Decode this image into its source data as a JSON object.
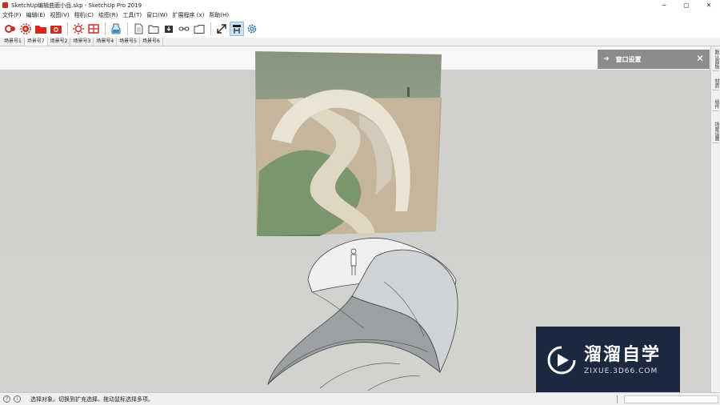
{
  "window": {
    "title": "SketchUp编辑曲面小品.skp - SketchUp Pro 2019",
    "minimize": "−",
    "maximize": "▢",
    "close": "✕"
  },
  "menu": [
    "文件(F)",
    "编辑(E)",
    "视图(V)",
    "相机(C)",
    "绘图(R)",
    "工具(T)",
    "窗口(W)",
    "扩展程序 (x)",
    "帮助(H)"
  ],
  "toolbar": {
    "icons": [
      "extension-warehouse-icon",
      "gear-sun-icon",
      "folder-red-icon",
      "camera-red-icon",
      "sun-settings-icon",
      "grid-panel-icon",
      "paint-bucket-icon",
      "document-icon",
      "folder-open-icon",
      "download-box-icon",
      "link-icon",
      "folder-outline-icon",
      "expand-icon",
      "scene-panel-icon",
      "settings-gear-icon"
    ],
    "active_index": 13
  },
  "scene_tabs": [
    "场景号1",
    "场景号7",
    "场景号2",
    "场景号3",
    "场景号4",
    "场景号5",
    "场景号6"
  ],
  "active_scene": 1,
  "tray": {
    "title": "窗口设置",
    "close": "✕",
    "side_tabs": [
      "默认面板",
      "材质",
      "组件",
      "场景设置"
    ]
  },
  "watermark": {
    "name": "溜溜自学",
    "url": "ZIXUE.3D66.COM"
  },
  "status": {
    "message": "选择对象。切换到扩充选择。拖动鼠标选择多项。"
  },
  "colors": {
    "viewport_floor": "#cfcfcc",
    "viewport_sky": "#f7f7f7",
    "tray_header": "#8c8c8c",
    "watermark_bg": "#1c2840",
    "accent_red": "#d8261b"
  }
}
